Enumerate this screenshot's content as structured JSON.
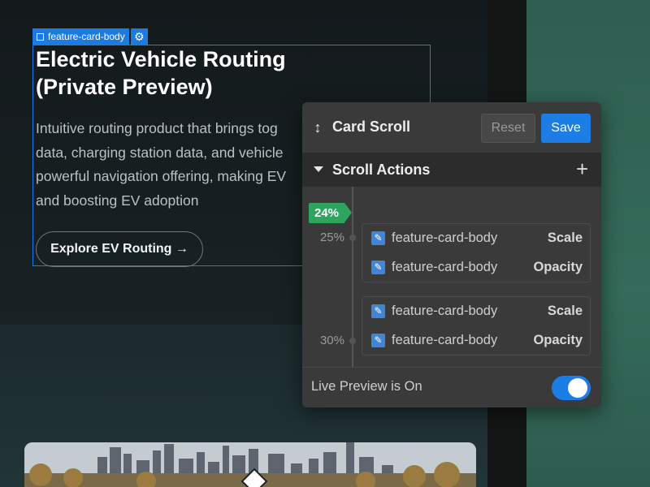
{
  "selection": {
    "element_name": "feature-card-body"
  },
  "card": {
    "title_line1": "Electric Vehicle Routing",
    "title_line2": "(Private Preview)",
    "desc_lines": [
      "Intuitive routing product that brings tog",
      "data, charging station data, and vehicle",
      "powerful navigation offering, making EV",
      "and boosting EV adoption"
    ],
    "cta_label": "Explore EV Routing →"
  },
  "panel": {
    "title": "Card Scroll",
    "reset_label": "Reset",
    "save_label": "Save",
    "actions_title": "Scroll Actions",
    "progress": "24%",
    "keyframes": [
      {
        "percent": "25%",
        "actions": [
          {
            "target": "feature-card-body",
            "type": "Scale"
          },
          {
            "target": "feature-card-body",
            "type": "Opacity"
          }
        ]
      },
      {
        "percent": "30%",
        "actions": [
          {
            "target": "feature-card-body",
            "type": "Scale"
          },
          {
            "target": "feature-card-body",
            "type": "Opacity"
          }
        ]
      }
    ],
    "live_preview_label": "Live Preview is On",
    "live_preview_on": true
  },
  "icons": {
    "selection": "element-square-icon",
    "settings": "gear-icon",
    "scroll": "vertical-arrows-icon",
    "collapse": "caret-down-icon",
    "add": "plus-icon",
    "action": "brush-icon"
  },
  "colors": {
    "accent": "#1d7de6",
    "progress": "#2da55e",
    "panel_bg": "#3a3a3a"
  }
}
